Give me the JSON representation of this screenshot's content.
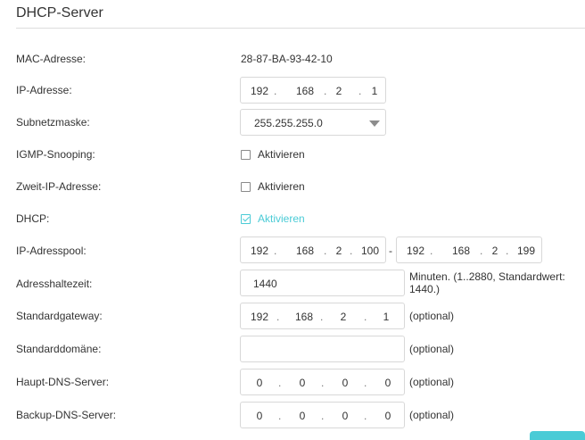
{
  "page": {
    "title": "DHCP-Server"
  },
  "mac": {
    "label": "MAC-Adresse:",
    "value": "28-87-BA-93-42-10"
  },
  "ip": {
    "label": "IP-Adresse:",
    "octets": [
      "192",
      "168",
      "2",
      "1"
    ]
  },
  "subnet": {
    "label": "Subnetzmaske:",
    "value": "255.255.255.0"
  },
  "igmp": {
    "label": "IGMP-Snooping:",
    "option": "Aktivieren",
    "checked": false
  },
  "second_ip": {
    "label": "Zweit-IP-Adresse:",
    "option": "Aktivieren",
    "checked": false
  },
  "dhcp": {
    "label": "DHCP:",
    "option": "Aktivieren",
    "checked": true
  },
  "pool": {
    "label": "IP-Adresspool:",
    "start": [
      "192",
      "168",
      "2",
      "100"
    ],
    "separator": "-",
    "end": [
      "192",
      "168",
      "2",
      "199"
    ]
  },
  "lease": {
    "label": "Adresshaltezeit:",
    "value": "1440",
    "hint_line1": "Minuten. (1..2880, Standardwert:",
    "hint_line2": "1440.)"
  },
  "gateway": {
    "label": "Standardgateway:",
    "octets": [
      "192",
      "168",
      "2",
      "1"
    ],
    "hint": "(optional)"
  },
  "domain": {
    "label": "Standarddomäne:",
    "value": "",
    "hint": "(optional)"
  },
  "dns1": {
    "label": "Haupt-DNS-Server:",
    "octets": [
      "0",
      "0",
      "0",
      "0"
    ],
    "hint": "(optional)"
  },
  "dns2": {
    "label": "Backup-DNS-Server:",
    "octets": [
      "0",
      "0",
      "0",
      "0"
    ],
    "hint": "(optional)"
  },
  "colors": {
    "accent": "#4acbd6",
    "border": "#d8d8d8",
    "text": "#333333"
  }
}
